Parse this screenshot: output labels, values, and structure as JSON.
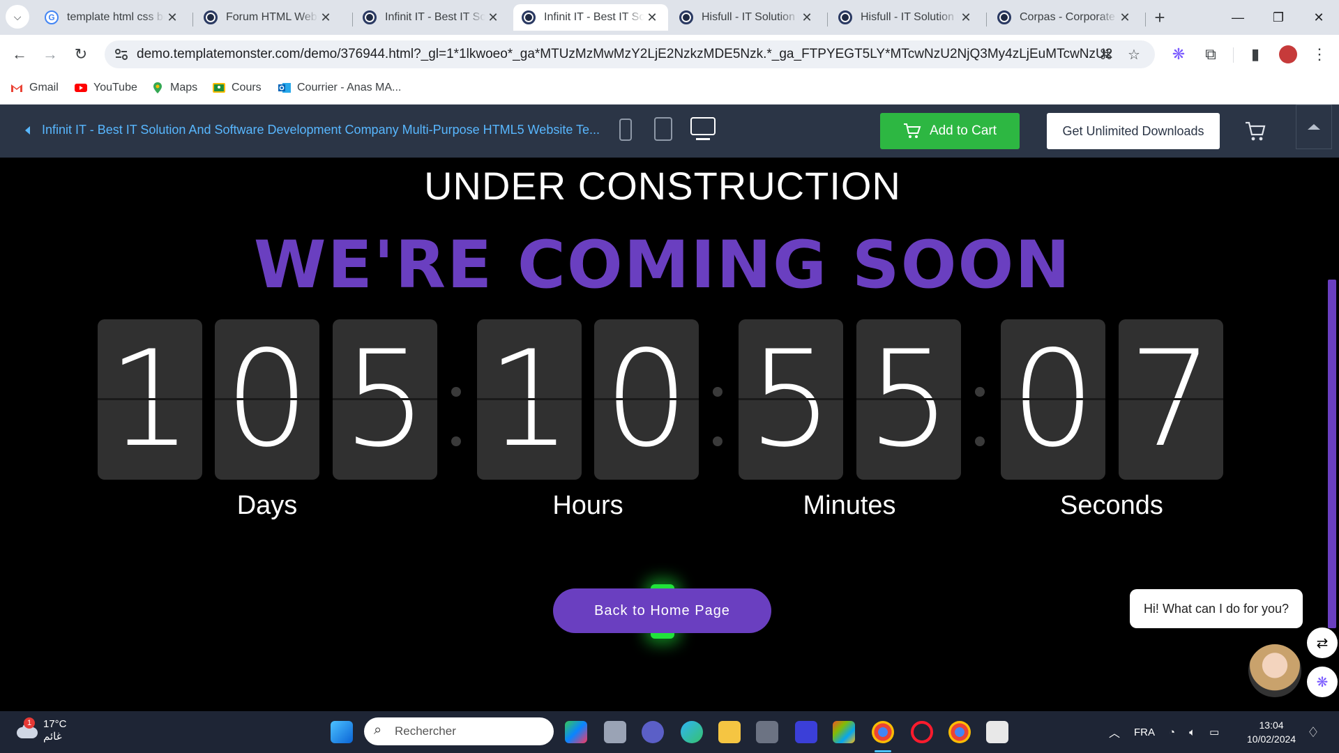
{
  "browser": {
    "tabs": [
      {
        "title": "template html css bo",
        "favicon": "google-icon"
      },
      {
        "title": "Forum HTML Website",
        "favicon": "templatemonster-icon"
      },
      {
        "title": "Infinit IT - Best IT Sol",
        "favicon": "templatemonster-icon"
      },
      {
        "title": "Infinit IT - Best IT Sol",
        "favicon": "templatemonster-icon",
        "active": true
      },
      {
        "title": "Hisfull - IT Solution R",
        "favicon": "templatemonster-icon"
      },
      {
        "title": "Hisfull - IT Solution R",
        "favicon": "templatemonster-icon"
      },
      {
        "title": "Corpas - Corporate R",
        "favicon": "templatemonster-icon"
      }
    ],
    "url": "demo.templatemonster.com/demo/376944.html?_gl=1*1lkwoeo*_ga*MTUzMzMwMzY2LjE2NzkzMDE5Nzk.*_ga_FTPYEGT5LY*MTcwNzU2NjQ3My4zLjEuMTcwNzU2NjY0MC40MC...",
    "bookmarks": [
      {
        "label": "Gmail",
        "icon": "gmail-icon"
      },
      {
        "label": "YouTube",
        "icon": "youtube-icon"
      },
      {
        "label": "Maps",
        "icon": "maps-icon"
      },
      {
        "label": "Cours",
        "icon": "classroom-icon"
      },
      {
        "label": "Courrier - Anas MA...",
        "icon": "outlook-icon"
      }
    ]
  },
  "tm_bar": {
    "title": "Infinit IT - Best IT Solution And Software Development Company Multi-Purpose HTML5 Website Te...",
    "add_to_cart": "Add to Cart",
    "unlimited": "Get Unlimited Downloads"
  },
  "page": {
    "heading": "UNDER CONSTRUCTION",
    "subheading": "WE'RE COMING SOON",
    "countdown": {
      "days": [
        "1",
        "0",
        "5"
      ],
      "hours": [
        "1",
        "0"
      ],
      "minutes": [
        "5",
        "5"
      ],
      "seconds": [
        "0",
        "7"
      ],
      "labels": {
        "days": "Days",
        "hours": "Hours",
        "minutes": "Minutes",
        "seconds": "Seconds"
      }
    },
    "home_button": "Back to Home Page",
    "chat_message": "Hi! What can I do for you?",
    "colors": {
      "accent": "#6a3fc0",
      "glow": "#21e33a",
      "tm_green": "#2db742"
    }
  },
  "taskbar": {
    "weather_temp": "17°C",
    "weather_desc": "غائم",
    "weather_badge": "1",
    "search_placeholder": "Rechercher",
    "language": "FRA",
    "time": "13:04",
    "date": "10/02/2024"
  }
}
